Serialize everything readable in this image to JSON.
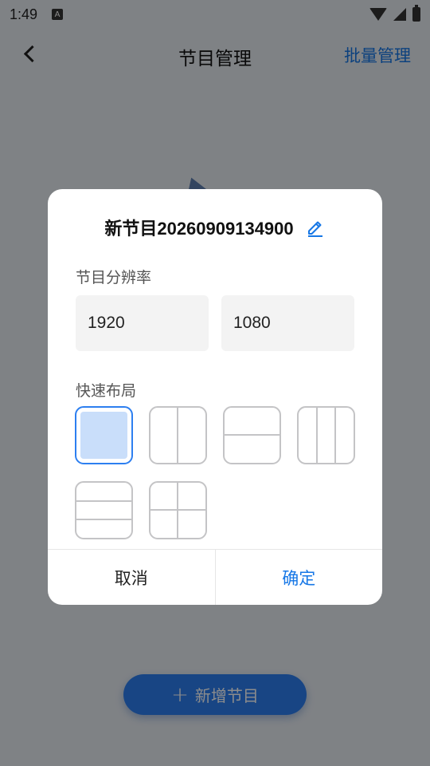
{
  "status_bar": {
    "time": "1:49",
    "notification_badge": "A"
  },
  "header": {
    "title": "节目管理",
    "batch_label": "批量管理"
  },
  "add_button": {
    "plus": "+",
    "label": "新增节目"
  },
  "dialog": {
    "title": "新节目20260909134900",
    "resolution_label": "节目分辨率",
    "width_value": "1920",
    "height_value": "1080",
    "layout_label": "快速布局",
    "layouts": [
      "single",
      "two-columns",
      "two-rows",
      "three-columns",
      "three-rows",
      "four-grid"
    ],
    "selected_layout": "single",
    "cancel_label": "取消",
    "confirm_label": "确定"
  },
  "colors": {
    "accent": "#1677e6",
    "selected_fill": "#c9defa",
    "overlay": "rgba(0,0,0,0.45)"
  },
  "icons": [
    "back-chevron-icon",
    "edit-pencil-icon",
    "plus-icon",
    "wifi-icon",
    "signal-icon",
    "battery-icon"
  ]
}
